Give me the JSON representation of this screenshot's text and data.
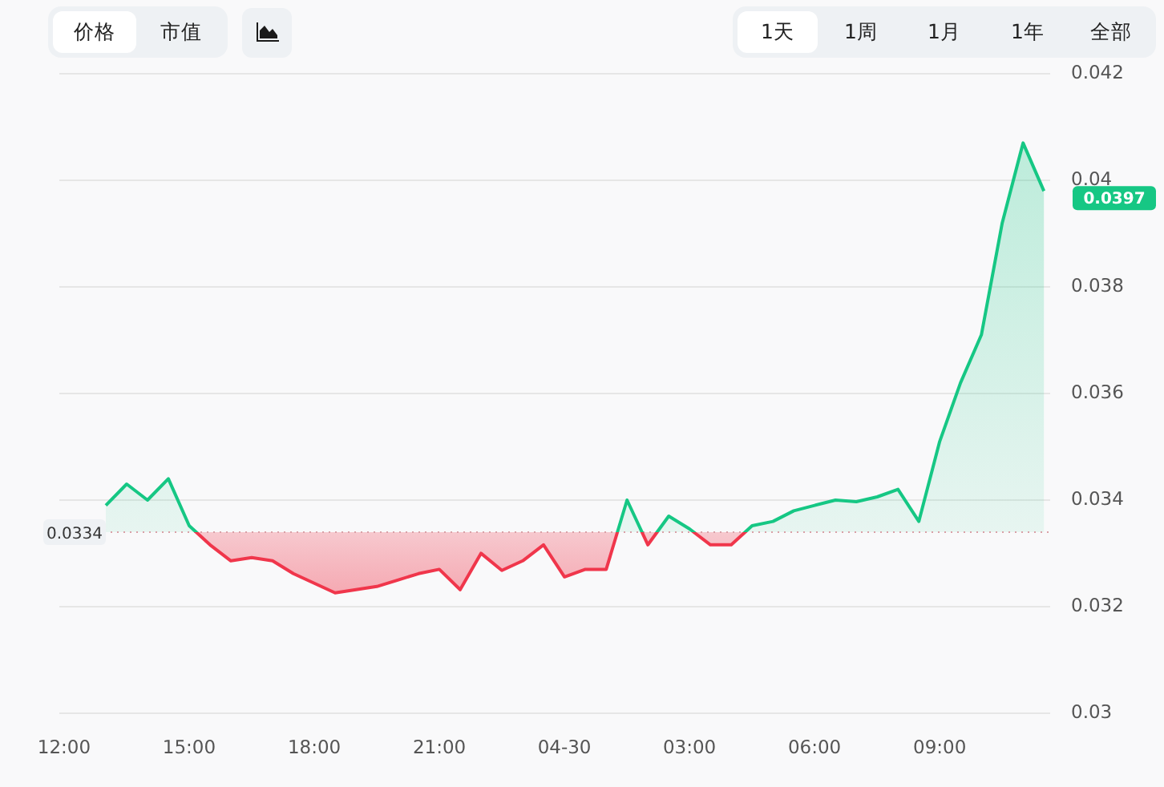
{
  "metric_tabs": [
    {
      "label": "价格",
      "selected": true
    },
    {
      "label": "市值",
      "selected": false
    }
  ],
  "range_tabs": [
    {
      "label": "1天",
      "selected": true
    },
    {
      "label": "1周",
      "selected": false
    },
    {
      "label": "1月",
      "selected": false
    },
    {
      "label": "1年",
      "selected": false
    },
    {
      "label": "全部",
      "selected": false
    }
  ],
  "last_price": {
    "label": "0.0397"
  },
  "chart_data": {
    "type": "area",
    "ylim": [
      0.03,
      0.042
    ],
    "grid": true,
    "ref_lines": [
      {
        "value": 0.0334,
        "axis": "y",
        "label": "0.0334"
      }
    ],
    "yticks": [
      0.03,
      0.032,
      0.034,
      0.036,
      0.038,
      0.04,
      0.042
    ],
    "categories": [
      "12:00",
      null,
      null,
      null,
      null,
      null,
      "15:00",
      null,
      null,
      null,
      null,
      null,
      "18:00",
      null,
      null,
      null,
      null,
      null,
      "21:00",
      null,
      null,
      null,
      null,
      null,
      "04-30",
      null,
      null,
      null,
      null,
      null,
      "03:00",
      null,
      null,
      null,
      null,
      null,
      "06:00",
      null,
      null,
      null,
      null,
      null,
      "09:00",
      null,
      null,
      null,
      null,
      null
    ],
    "series": [
      {
        "color": "#16c784",
        "values": [
          null,
          null,
          0.0339,
          0.0343,
          0.034,
          0.0344,
          0.03352,
          0.03316,
          0.03286,
          0.03292,
          0.03286,
          0.03262,
          0.03244,
          0.03226,
          0.03232,
          0.03238,
          0.0325,
          0.03262,
          0.0327,
          0.03232,
          0.033,
          0.03268,
          0.03286,
          0.03316,
          0.03256,
          0.0327,
          0.0327,
          0.034,
          0.03316,
          0.0337,
          0.03346,
          0.03316,
          0.03316,
          0.03352,
          0.0336,
          0.0338,
          0.0339,
          0.034,
          0.03397,
          0.03406,
          0.0342,
          0.0336,
          0.0351,
          0.0362,
          0.0371,
          0.0392,
          0.0407,
          0.0398
        ]
      }
    ]
  }
}
